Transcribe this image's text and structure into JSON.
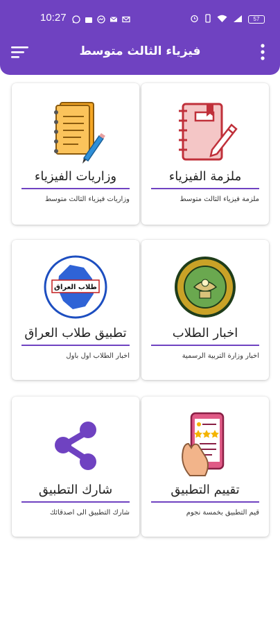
{
  "status_bar": {
    "time": "10:27",
    "battery": "57"
  },
  "toolbar": {
    "title": "فيزياء الثالث متوسط"
  },
  "colors": {
    "primary": "#6f42c1",
    "card_bg": "#ffffff"
  },
  "cards": [
    {
      "title": "ملزمة الفيزياء",
      "subtitle": "ملزمة فيزياء الثالث متوسط",
      "icon": "notebook-pen-icon"
    },
    {
      "title": "وزاريات الفيزياء",
      "subtitle": "وزاريات فيزياء الثالث متوسط",
      "icon": "notepad-pencil-icon"
    },
    {
      "title": "اخبار الطلاب",
      "subtitle": "اخبار وزارة التربية الرسمية",
      "icon": "ministry-seal-icon"
    },
    {
      "title": "تطبيق طلاب العراق",
      "subtitle": "اخبار الطلاب اول باول",
      "icon": "iraq-map-logo-icon",
      "logo_text": "طلاب العراق"
    },
    {
      "title": "تقييم التطبيق",
      "subtitle": "قيم التطبيق بخمسة نجوم",
      "icon": "rate-phone-icon"
    },
    {
      "title": "شارك التطبيق",
      "subtitle": "شارك التطبيق الى اصدقائك",
      "icon": "share-icon"
    }
  ]
}
